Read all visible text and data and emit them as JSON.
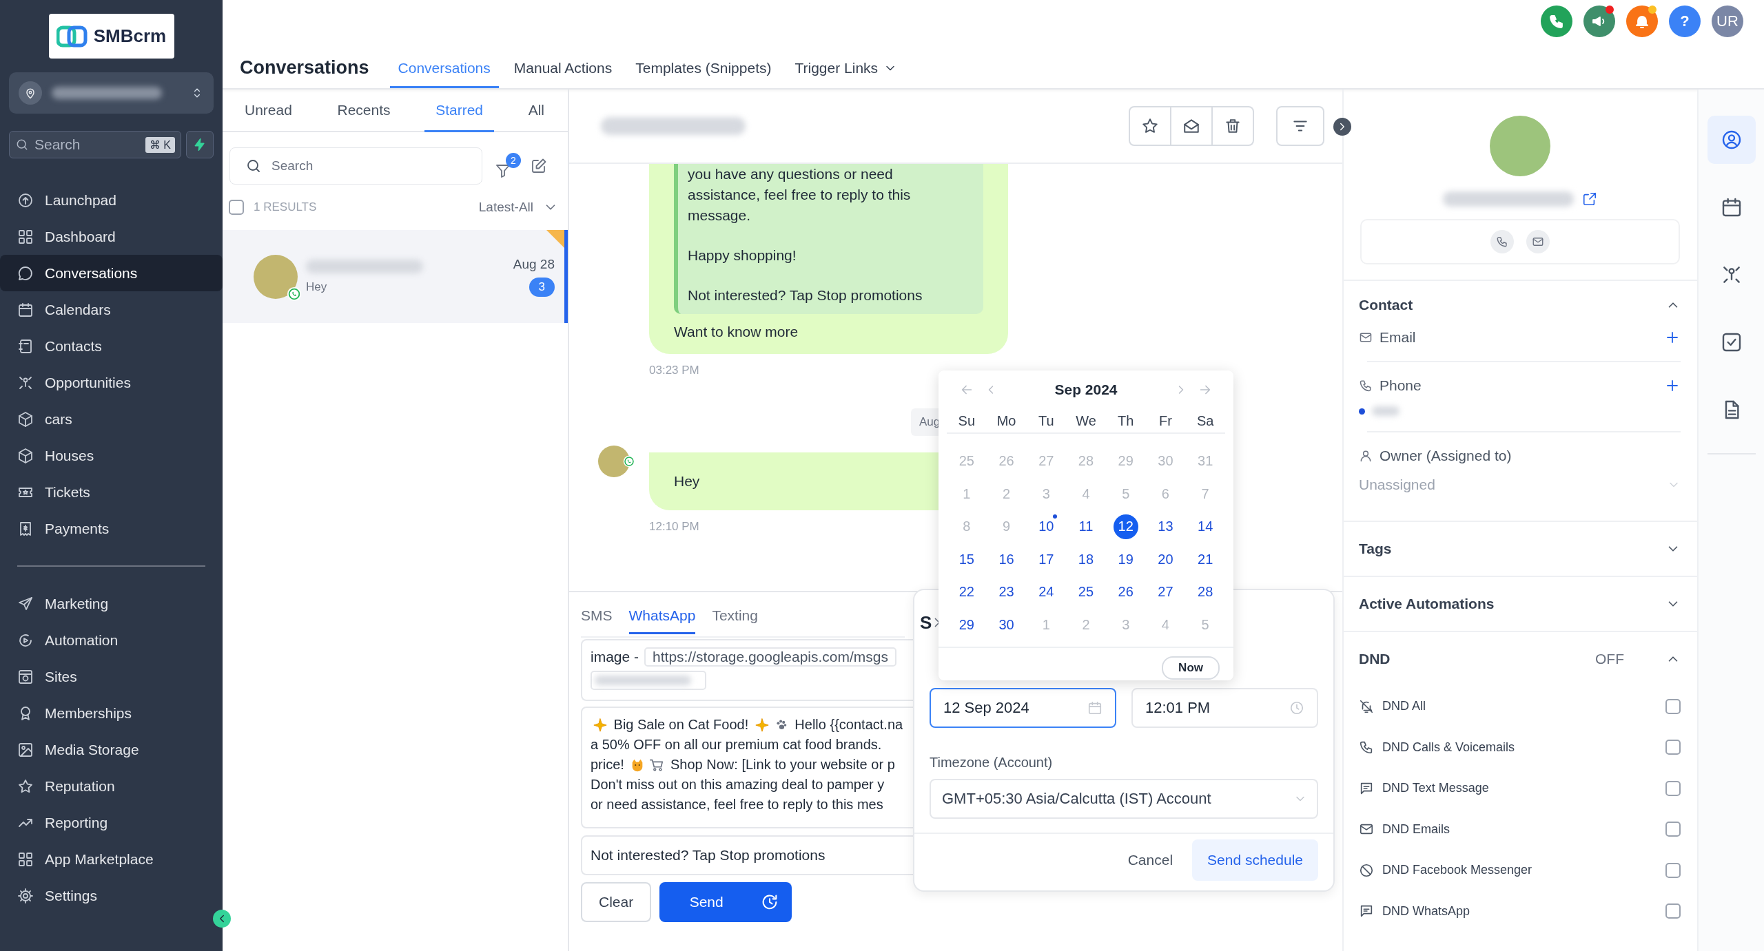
{
  "brand": {
    "name": "SMBcrm"
  },
  "sidebar": {
    "search": {
      "placeholder": "Search",
      "shortcut": "⌘ K"
    },
    "groups": [
      [
        {
          "label": "Launchpad",
          "selected": false
        },
        {
          "label": "Dashboard",
          "selected": false
        },
        {
          "label": "Conversations",
          "selected": true
        },
        {
          "label": "Calendars",
          "selected": false
        },
        {
          "label": "Contacts",
          "selected": false
        },
        {
          "label": "Opportunities",
          "selected": false
        },
        {
          "label": "cars",
          "selected": false
        },
        {
          "label": "Houses",
          "selected": false
        },
        {
          "label": "Tickets",
          "selected": false
        },
        {
          "label": "Payments",
          "selected": false
        }
      ],
      [
        {
          "label": "Marketing",
          "selected": false
        },
        {
          "label": "Automation",
          "selected": false
        },
        {
          "label": "Sites",
          "selected": false
        },
        {
          "label": "Memberships",
          "selected": false
        },
        {
          "label": "Media Storage",
          "selected": false
        },
        {
          "label": "Reputation",
          "selected": false
        },
        {
          "label": "Reporting",
          "selected": false
        },
        {
          "label": "App Marketplace",
          "selected": false
        }
      ]
    ],
    "settings": {
      "label": "Settings",
      "selected": false
    }
  },
  "header": {
    "title": "Conversations",
    "tabs": [
      {
        "label": "Conversations",
        "selected": true,
        "dropdown": false
      },
      {
        "label": "Manual Actions",
        "selected": false,
        "dropdown": false
      },
      {
        "label": "Templates (Snippets)",
        "selected": false,
        "dropdown": false
      },
      {
        "label": "Trigger Links",
        "selected": false,
        "dropdown": true
      }
    ],
    "actions": [
      {
        "kind": "phone",
        "alert": false
      },
      {
        "kind": "megaphone",
        "alert": true
      },
      {
        "kind": "bell",
        "alert": true
      },
      {
        "kind": "help",
        "label": "?",
        "alert": false
      },
      {
        "kind": "user",
        "label": "UR",
        "alert": false
      }
    ]
  },
  "conversation_list": {
    "tabs": [
      {
        "label": "Unread",
        "selected": false
      },
      {
        "label": "Recents",
        "selected": false
      },
      {
        "label": "Starred",
        "selected": true
      },
      {
        "label": "All",
        "selected": false
      }
    ],
    "search": {
      "placeholder": "Search"
    },
    "filter_count": "2",
    "select_all": {
      "checked": false
    },
    "results": "1 RESULTS",
    "sort": "Latest-All",
    "conversations": [
      {
        "preview": "Hey",
        "date": "Aug 28",
        "unread": "3",
        "whatsapp": true,
        "starred": true,
        "selected": true
      }
    ]
  },
  "chat": {
    "messages": [
      {
        "kind": "outgoing",
        "quote": [
          "you have any questions or need\nassistance, feel free to reply to this\nmessage.",
          "Happy shopping!",
          "Not interested? Tap Stop promotions"
        ],
        "text": "Want to know more",
        "time": "03:23 PM"
      },
      {
        "kind": "date",
        "text": "Aug"
      },
      {
        "kind": "incoming",
        "whatsapp": true,
        "text": "Hey",
        "time": "12:10 PM"
      }
    ]
  },
  "composer": {
    "tabs": [
      {
        "label": "SMS",
        "selected": false
      },
      {
        "label": "WhatsApp",
        "selected": true
      },
      {
        "label": "Texting",
        "selected": false
      }
    ],
    "attachment": {
      "label": "image -",
      "url": "https://storage.googleapis.com/msgs"
    },
    "body_lines": [
      [
        {
          "kind": "sparkle"
        },
        {
          "kind": "text",
          "text": " Big Sale on Cat Food! "
        },
        {
          "kind": "sparkle"
        },
        {
          "kind": "paw"
        },
        {
          "kind": "text",
          "text": " Hello {{contact.na"
        }
      ],
      [
        {
          "kind": "text",
          "text": "a 50% OFF on all our premium cat food brands."
        }
      ],
      [
        {
          "kind": "text",
          "text": "price! "
        },
        {
          "kind": "cat"
        },
        {
          "kind": "cart"
        },
        {
          "kind": "text",
          "text": " Shop Now: [Link to your website or p"
        }
      ],
      [
        {
          "kind": "text",
          "text": "Don't miss out on this amazing deal to pamper y"
        }
      ],
      [
        {
          "kind": "text",
          "text": "or need assistance, feel free to reply to this mes"
        }
      ]
    ],
    "footer_text": "Not interested? Tap Stop promotions",
    "clear": "Clear",
    "send": "Send"
  },
  "schedule_dialog": {
    "title": "S",
    "date": "12 Sep 2024",
    "time": "12:01 PM",
    "timezone_label": "Timezone (Account)",
    "timezone": "GMT+05:30 Asia/Calcutta (IST) Account",
    "cancel": "Cancel",
    "confirm": "Send schedule"
  },
  "date_picker": {
    "month": "Sep 2024",
    "weekdays": [
      "Su",
      "Mo",
      "Tu",
      "We",
      "Th",
      "Fr",
      "Sa"
    ],
    "now": "Now",
    "weeks": [
      [
        {
          "day": "25",
          "muted": true,
          "selected": false,
          "marked": false
        },
        {
          "day": "26",
          "muted": true,
          "selected": false,
          "marked": false
        },
        {
          "day": "27",
          "muted": true,
          "selected": false,
          "marked": false
        },
        {
          "day": "28",
          "muted": true,
          "selected": false,
          "marked": false
        },
        {
          "day": "29",
          "muted": true,
          "selected": false,
          "marked": false
        },
        {
          "day": "30",
          "muted": true,
          "selected": false,
          "marked": false
        },
        {
          "day": "31",
          "muted": true,
          "selected": false,
          "marked": false
        }
      ],
      [
        {
          "day": "1",
          "muted": true,
          "selected": false,
          "marked": false
        },
        {
          "day": "2",
          "muted": true,
          "selected": false,
          "marked": false
        },
        {
          "day": "3",
          "muted": true,
          "selected": false,
          "marked": false
        },
        {
          "day": "4",
          "muted": true,
          "selected": false,
          "marked": false
        },
        {
          "day": "5",
          "muted": true,
          "selected": false,
          "marked": false
        },
        {
          "day": "6",
          "muted": true,
          "selected": false,
          "marked": false
        },
        {
          "day": "7",
          "muted": true,
          "selected": false,
          "marked": false
        }
      ],
      [
        {
          "day": "8",
          "muted": true,
          "selected": false,
          "marked": false
        },
        {
          "day": "9",
          "muted": true,
          "selected": false,
          "marked": false
        },
        {
          "day": "10",
          "muted": false,
          "selected": false,
          "marked": true
        },
        {
          "day": "11",
          "muted": false,
          "selected": false,
          "marked": false
        },
        {
          "day": "12",
          "muted": false,
          "selected": true,
          "marked": false
        },
        {
          "day": "13",
          "muted": false,
          "selected": false,
          "marked": false
        },
        {
          "day": "14",
          "muted": false,
          "selected": false,
          "marked": false
        }
      ],
      [
        {
          "day": "15",
          "muted": false,
          "selected": false,
          "marked": false
        },
        {
          "day": "16",
          "muted": false,
          "selected": false,
          "marked": false
        },
        {
          "day": "17",
          "muted": false,
          "selected": false,
          "marked": false
        },
        {
          "day": "18",
          "muted": false,
          "selected": false,
          "marked": false
        },
        {
          "day": "19",
          "muted": false,
          "selected": false,
          "marked": false
        },
        {
          "day": "20",
          "muted": false,
          "selected": false,
          "marked": false
        },
        {
          "day": "21",
          "muted": false,
          "selected": false,
          "marked": false
        }
      ],
      [
        {
          "day": "22",
          "muted": false,
          "selected": false,
          "marked": false
        },
        {
          "day": "23",
          "muted": false,
          "selected": false,
          "marked": false
        },
        {
          "day": "24",
          "muted": false,
          "selected": false,
          "marked": false
        },
        {
          "day": "25",
          "muted": false,
          "selected": false,
          "marked": false
        },
        {
          "day": "26",
          "muted": false,
          "selected": false,
          "marked": false
        },
        {
          "day": "27",
          "muted": false,
          "selected": false,
          "marked": false
        },
        {
          "day": "28",
          "muted": false,
          "selected": false,
          "marked": false
        }
      ],
      [
        {
          "day": "29",
          "muted": false,
          "selected": false,
          "marked": false
        },
        {
          "day": "30",
          "muted": false,
          "selected": false,
          "marked": false
        },
        {
          "day": "1",
          "muted": true,
          "selected": false,
          "marked": false
        },
        {
          "day": "2",
          "muted": true,
          "selected": false,
          "marked": false
        },
        {
          "day": "3",
          "muted": true,
          "selected": false,
          "marked": false
        },
        {
          "day": "4",
          "muted": true,
          "selected": false,
          "marked": false
        },
        {
          "day": "5",
          "muted": true,
          "selected": false,
          "marked": false
        }
      ]
    ]
  },
  "contact_panel": {
    "contact": {
      "title": "Contact",
      "expanded": true,
      "fields": [
        {
          "label": "Email"
        },
        {
          "label": "Phone"
        }
      ]
    },
    "owner": {
      "label": "Owner (Assigned to)",
      "value": "Unassigned"
    },
    "sections": [
      {
        "title": "Tags",
        "expanded": false
      },
      {
        "title": "Active Automations",
        "expanded": false
      }
    ],
    "dnd": {
      "title": "DND",
      "status": "OFF",
      "expanded": true,
      "items": [
        {
          "label": "DND All",
          "checked": false
        },
        {
          "label": "DND Calls & Voicemails",
          "checked": false
        },
        {
          "label": "DND Text Message",
          "checked": false
        },
        {
          "label": "DND Emails",
          "checked": false
        },
        {
          "label": "DND Facebook Messenger",
          "checked": false
        },
        {
          "label": "DND WhatsApp",
          "checked": false
        }
      ]
    }
  },
  "rail": [
    {
      "selected": true
    },
    {
      "selected": false
    },
    {
      "selected": false
    },
    {
      "selected": false
    },
    {
      "selected": false
    }
  ]
}
